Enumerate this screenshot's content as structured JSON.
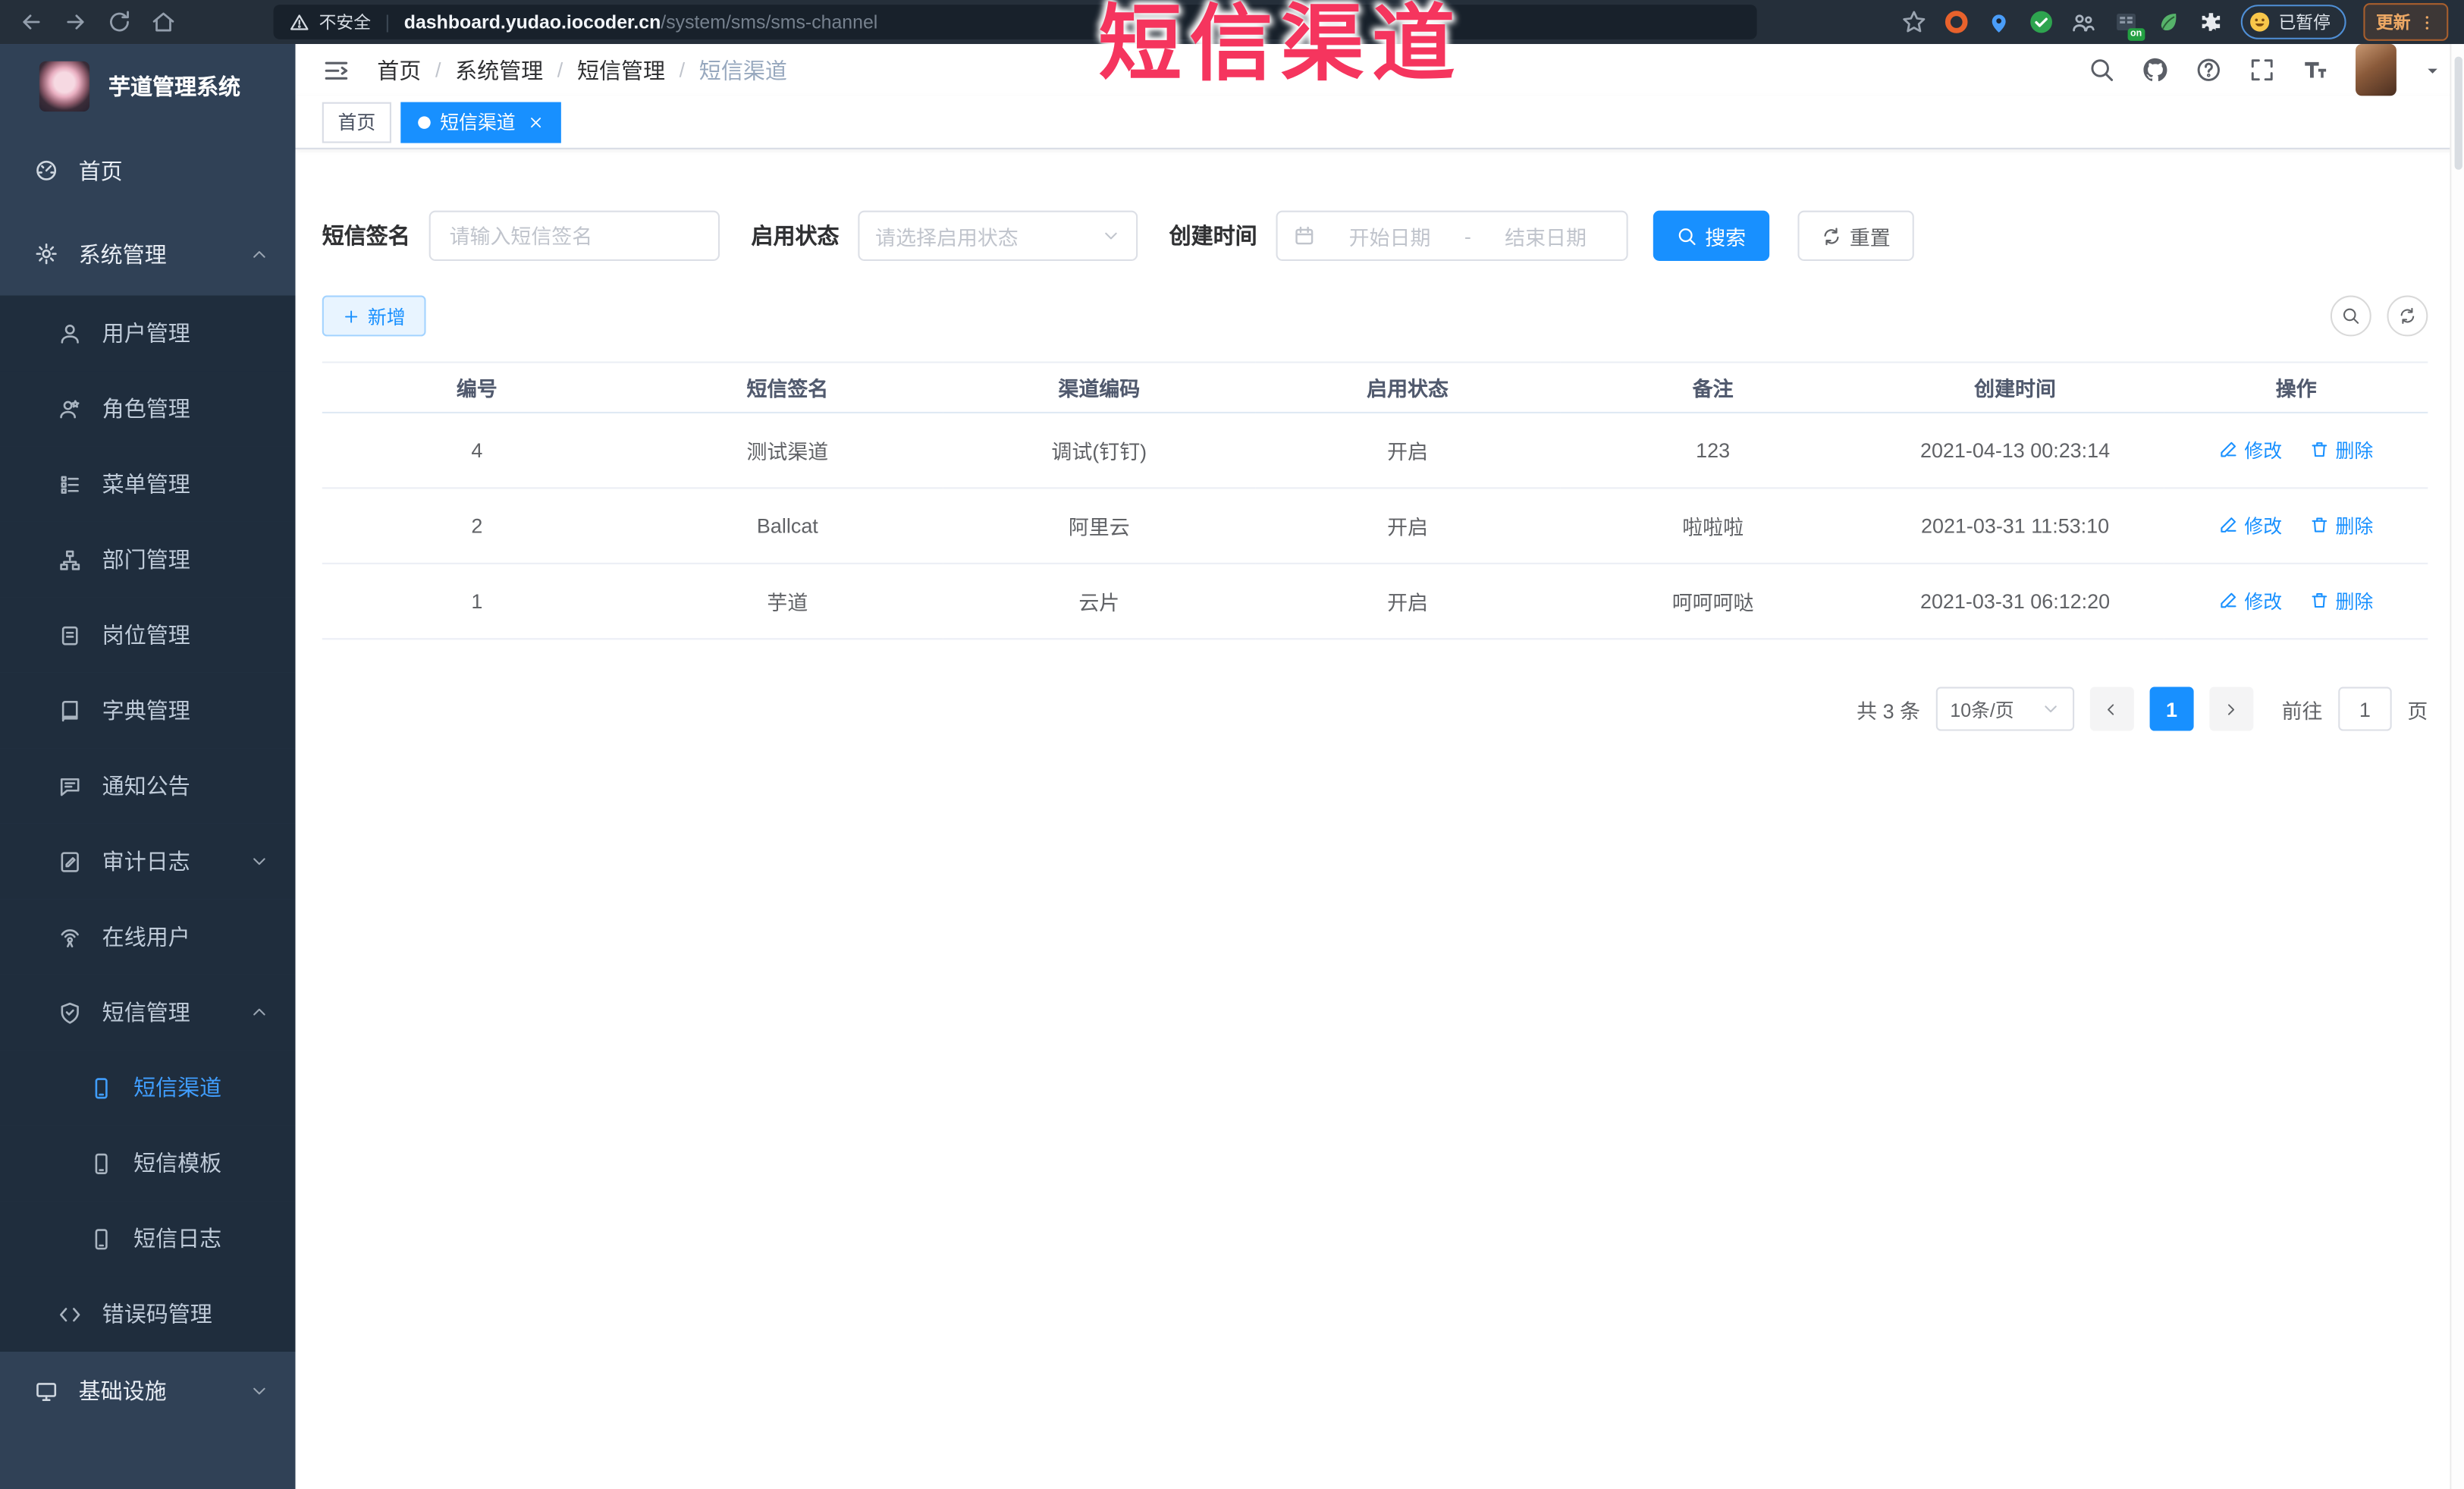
{
  "browser": {
    "not_secure_label": "不安全",
    "url_domain": "dashboard.yudao.iocoder.cn",
    "url_path": "/system/sms/sms-channel",
    "paused_label": "已暂停",
    "ext_on_badge": "on",
    "update_label": "更新"
  },
  "overlay_title": "短信渠道",
  "sidebar": {
    "logo_title": "芋道管理系统",
    "items": [
      {
        "key": "home",
        "label": "首页",
        "icon": "dashboard-icon",
        "level": 1
      },
      {
        "key": "system",
        "label": "系统管理",
        "icon": "gear-icon",
        "level": 1,
        "chevron": "up"
      },
      {
        "key": "user",
        "label": "用户管理",
        "icon": "user-icon",
        "level": 2
      },
      {
        "key": "role",
        "label": "角色管理",
        "icon": "role-icon",
        "level": 2
      },
      {
        "key": "menu",
        "label": "菜单管理",
        "icon": "menu-list-icon",
        "level": 2
      },
      {
        "key": "dept",
        "label": "部门管理",
        "icon": "org-tree-icon",
        "level": 2
      },
      {
        "key": "post",
        "label": "岗位管理",
        "icon": "post-icon",
        "level": 2
      },
      {
        "key": "dict",
        "label": "字典管理",
        "icon": "dict-book-icon",
        "level": 2
      },
      {
        "key": "notice",
        "label": "通知公告",
        "icon": "announcement-icon",
        "level": 2
      },
      {
        "key": "audit-log",
        "label": "审计日志",
        "icon": "audit-log-icon",
        "level": 2,
        "chevron": "down"
      },
      {
        "key": "online-user",
        "label": "在线用户",
        "icon": "online-user-icon",
        "level": 2
      },
      {
        "key": "sms",
        "label": "短信管理",
        "icon": "sms-shield-icon",
        "level": 2,
        "chevron": "up"
      },
      {
        "key": "sms-channel",
        "label": "短信渠道",
        "icon": "phone-icon",
        "level": 3,
        "active": true
      },
      {
        "key": "sms-template",
        "label": "短信模板",
        "icon": "phone-icon",
        "level": 3
      },
      {
        "key": "sms-log",
        "label": "短信日志",
        "icon": "phone-icon",
        "level": 3
      },
      {
        "key": "error-code",
        "label": "错误码管理",
        "icon": "code-icon",
        "level": 2
      },
      {
        "key": "infra",
        "label": "基础设施",
        "icon": "monitor-icon",
        "level": 1,
        "chevron": "down",
        "section": "bottom"
      }
    ]
  },
  "header": {
    "breadcrumb": [
      "首页",
      "系统管理",
      "短信管理",
      "短信渠道"
    ]
  },
  "tabs": [
    {
      "label": "首页",
      "active": false
    },
    {
      "label": "短信渠道",
      "active": true
    }
  ],
  "filters": {
    "sign_label": "短信签名",
    "sign_placeholder": "请输入短信签名",
    "status_label": "启用状态",
    "status_placeholder": "请选择启用状态",
    "time_label": "创建时间",
    "start_placeholder": "开始日期",
    "range_separator": "-",
    "end_placeholder": "结束日期",
    "search_label": "搜索",
    "reset_label": "重置"
  },
  "toolbar": {
    "add_label": "新增"
  },
  "table": {
    "columns": [
      "编号",
      "短信签名",
      "渠道编码",
      "启用状态",
      "备注",
      "创建时间",
      "操作"
    ],
    "edit_label": "修改",
    "delete_label": "删除",
    "rows": [
      {
        "id": "4",
        "sign": "测试渠道",
        "code": "调试(钉钉)",
        "status": "开启",
        "remark": "123",
        "created": "2021-04-13 00:23:14"
      },
      {
        "id": "2",
        "sign": "Ballcat",
        "code": "阿里云",
        "status": "开启",
        "remark": "啦啦啦",
        "created": "2021-03-31 11:53:10"
      },
      {
        "id": "1",
        "sign": "芋道",
        "code": "云片",
        "status": "开启",
        "remark": "呵呵呵哒",
        "created": "2021-03-31 06:12:20"
      }
    ]
  },
  "pagination": {
    "total_text": "共 3 条",
    "page_size": "10条/页",
    "current_page": "1",
    "goto_label": "前往",
    "goto_value": "1",
    "page_suffix": "页"
  },
  "colors": {
    "accent_blue": "#1890ff",
    "sidebar_bg": "#304156",
    "submenu_bg": "#1f2d3d",
    "overlay_red": "#f5355e"
  }
}
